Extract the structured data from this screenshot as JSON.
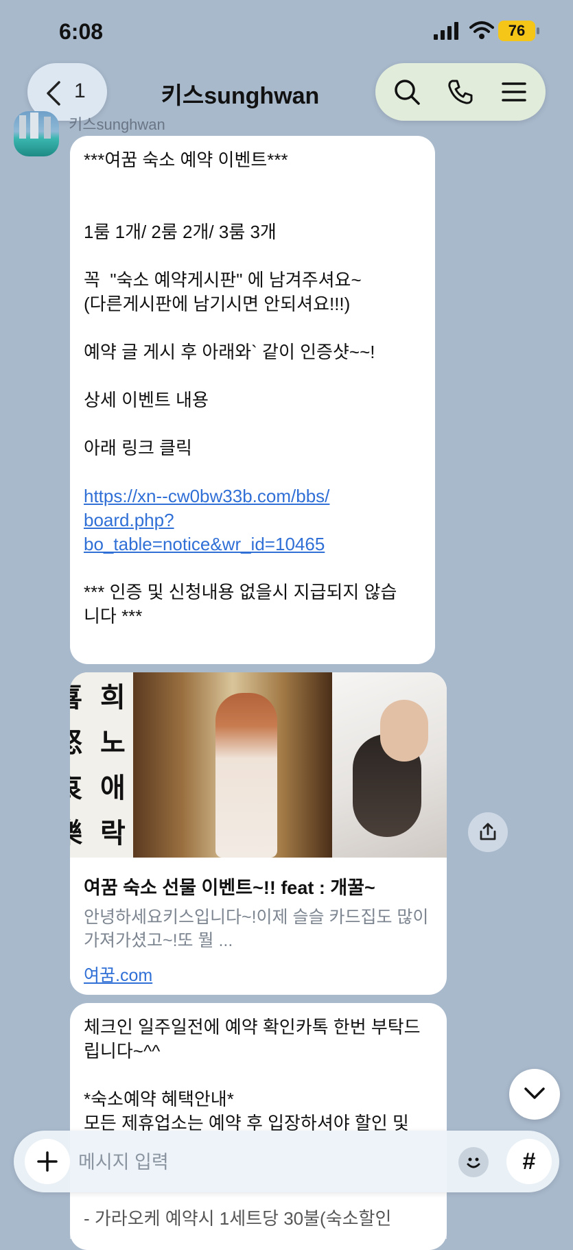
{
  "status_bar": {
    "time": "6:08",
    "battery": "76"
  },
  "nav": {
    "back_count": "1",
    "title": "키스sunghwan"
  },
  "sender": {
    "name": "키스sunghwan"
  },
  "message1": {
    "header": "***여꿈 숙소 예약 이벤트***",
    "rooms": "1룸 1개/ 2룸 2개/ 3룸 3개",
    "line_board": "꼭  \"숙소 예약게시판\" 에 남겨주셔요~\n(다른게시판에 남기시면 안되셔요!!!)",
    "line_proof": "예약 글 게시 후 아래와` 같이 인증샷~~!",
    "line_detail": "상세 이벤트 내용",
    "line_click": "아래 링크 클릭",
    "link": "https://xn--cw0bw33b.com/bbs/\nboard.php?\nbo_table=notice&wr_id=10465",
    "footer": "*** 인증 및 신청내용 없을시 지급되지 않습\n니다 ***"
  },
  "card": {
    "calligraphy": [
      "희",
      "노",
      "애",
      "락",
      "喜",
      "怒",
      "哀",
      "樂"
    ],
    "title": "여꿈 숙소 선물 이벤트~!! feat : 개꿀~",
    "description": "안녕하세요키스입니다~!이제 슬슬 카드집도 많이 가져가셨고~!또 뭘 ...",
    "domain": "여꿈.com"
  },
  "message2": {
    "text": "체크인 일주일전에 예약 확인카톡 한번 부탁드립니다~^^\n\n*숙소예약 혜택안내*\n모든 제휴업소는 예약 후 입장하셔야 할인 및"
  },
  "partial_below": "- 가라오케 예약시 1세트당 30불(숙소할인",
  "input": {
    "placeholder": "메시지 입력",
    "hash": "#"
  },
  "colors": {
    "background": "#a8b9cc",
    "link": "#2f6fd6",
    "battery": "#f5c518"
  }
}
